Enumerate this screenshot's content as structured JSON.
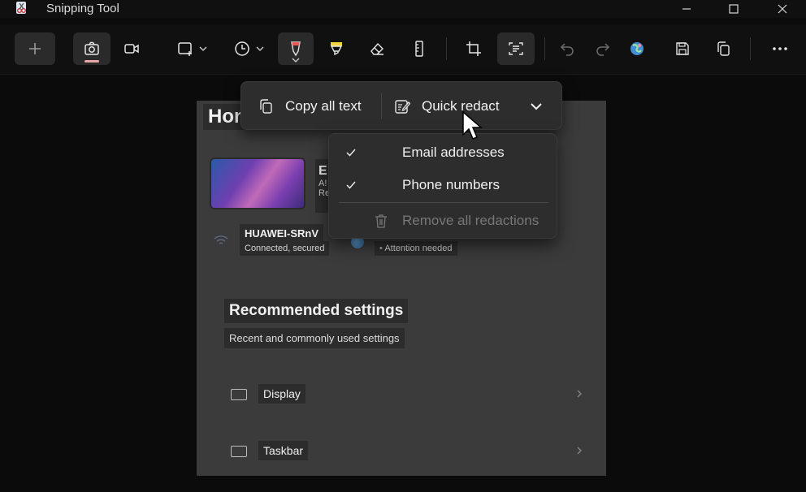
{
  "window": {
    "title": "Snipping Tool"
  },
  "toolbar": {
    "new_icon": "plus-icon",
    "camera_icon": "camera-icon",
    "video_icon": "video-icon",
    "snip_mode_icon": "rectangle-snip-icon",
    "delay_icon": "clock-icon",
    "pen_icon": "ballpoint-pen-icon",
    "highlighter_icon": "highlighter-icon",
    "eraser_icon": "eraser-icon",
    "ruler_icon": "ruler-icon",
    "crop_icon": "crop-icon",
    "text_actions_icon": "text-actions-icon",
    "undo_icon": "undo-icon",
    "redo_icon": "redo-icon",
    "edit_in_paint_icon": "paint-icon",
    "save_icon": "save-icon",
    "copy_icon": "copy-icon",
    "more_icon": "more-icon",
    "pen_color": "#e85a5a",
    "highlighter_color": "#f2d53c"
  },
  "text_actions": {
    "copy_all_text": "Copy all text",
    "quick_redact": "Quick redact"
  },
  "redact_menu": {
    "items": [
      {
        "label": "Email addresses",
        "checked": true
      },
      {
        "label": "Phone numbers",
        "checked": true
      }
    ],
    "remove_all": "Remove all redactions"
  },
  "screenshot": {
    "home_title": "Hon",
    "device_initial": "E",
    "device_line2": "A!",
    "device_line3": "Re",
    "wifi_name": "HUAWEI-SRnV",
    "wifi_status": "Connected, secured",
    "attention": "Attention needed",
    "recommended_title": "Recommended settings",
    "recommended_sub": "Recent and commonly used settings",
    "rows": [
      {
        "label": "Display"
      },
      {
        "label": "Taskbar"
      }
    ]
  }
}
